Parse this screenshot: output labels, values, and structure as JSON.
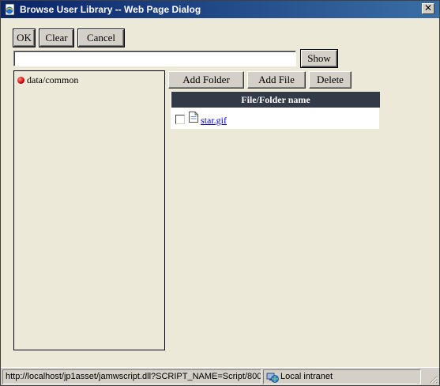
{
  "window": {
    "title": "Browse User Library -- Web Page Dialog",
    "close_glyph": "✕"
  },
  "toolbar": {
    "ok_label": "OK",
    "clear_label": "Clear",
    "cancel_label": "Cancel",
    "show_label": "Show"
  },
  "path_input": {
    "value": "",
    "placeholder": ""
  },
  "tree": {
    "items": [
      {
        "label": "data/common",
        "icon": "red-bullet-icon"
      }
    ]
  },
  "file_actions": {
    "add_folder_label": "Add Folder",
    "add_file_label": "Add File",
    "delete_label": "Delete"
  },
  "file_table": {
    "header": "File/Folder name",
    "rows": [
      {
        "name": "star.gif",
        "checked": false,
        "icon": "file-icon"
      }
    ]
  },
  "statusbar": {
    "url": "http://localhost/jp1asset/jamwscript.dll?SCRIPT_NAME=Script/800",
    "zone": "Local intranet"
  },
  "colors": {
    "titlebar_start": "#0a246a",
    "titlebar_end": "#3a6ea5",
    "table_header": "#323a48",
    "dialog_bg": "#ece9d8",
    "link": "#0000cc"
  }
}
